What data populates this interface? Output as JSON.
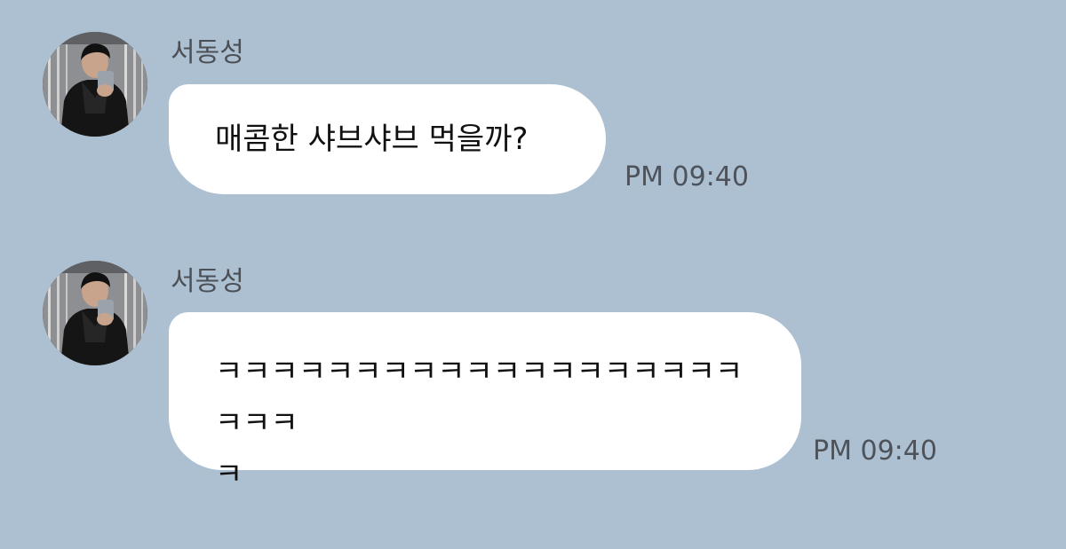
{
  "chat": {
    "messages": [
      {
        "sender": "서동성",
        "text": "매콤한 샤브샤브 먹을까?",
        "time": "PM 09:40"
      },
      {
        "sender": "서동성",
        "text": "ㅋㅋㅋㅋㅋㅋㅋㅋㅋㅋㅋㅋㅋㅋㅋㅋㅋㅋㅋㅋㅋㅋ\nㅋ",
        "time": "PM 09:40"
      }
    ]
  },
  "colors": {
    "background": "#adc0d2",
    "bubble": "#ffffff",
    "name_text": "#4b4f56",
    "time_text": "#4e535b"
  },
  "icons": {
    "avatar": "profile-photo"
  }
}
